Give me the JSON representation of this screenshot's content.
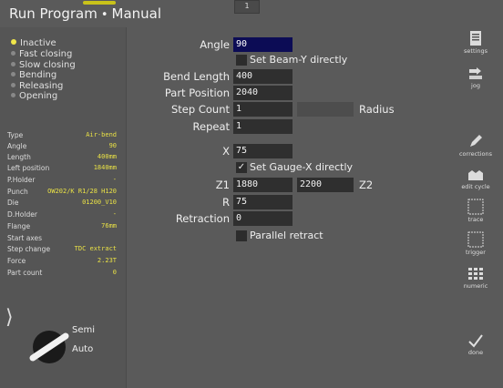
{
  "header": {
    "title_left": "Run Program",
    "title_sep": "•",
    "title_right": "Manual",
    "tab": "1"
  },
  "states": [
    {
      "label": "Inactive",
      "active": true
    },
    {
      "label": "Fast closing",
      "active": false
    },
    {
      "label": "Slow closing",
      "active": false
    },
    {
      "label": "Bending",
      "active": false
    },
    {
      "label": "Releasing",
      "active": false
    },
    {
      "label": "Opening",
      "active": false
    }
  ],
  "params": [
    {
      "k": "Type",
      "v": "Air-bend"
    },
    {
      "k": "Angle",
      "v": "90"
    },
    {
      "k": "Length",
      "v": "400mm"
    },
    {
      "k": "Left position",
      "v": "1840mm"
    },
    {
      "k": "P.Holder",
      "v": "-"
    },
    {
      "k": "Punch",
      "v": "OW202/K R1/28 H120"
    },
    {
      "k": "Die",
      "v": "01200_V10"
    },
    {
      "k": "D.Holder",
      "v": "-"
    },
    {
      "k": "Flange",
      "v": "76mm"
    },
    {
      "k": "Start axes",
      "v": ""
    },
    {
      "k": "Step change",
      "v": "TDC extract"
    },
    {
      "k": "Force",
      "v": "2.23T"
    },
    {
      "k": "Part count",
      "v": "0"
    }
  ],
  "mode": {
    "semi": "Semi",
    "auto": "Auto"
  },
  "form": {
    "angle_label": "Angle",
    "angle": "90",
    "set_beam_y": "Set Beam-Y directly",
    "bend_length_label": "Bend Length",
    "bend_length": "400",
    "part_position_label": "Part Position",
    "part_position": "2040",
    "step_count_label": "Step Count",
    "step_count": "1",
    "radius_label": "Radius",
    "repeat_label": "Repeat",
    "repeat": "1",
    "x_label": "X",
    "x": "75",
    "set_gauge_x": "Set Gauge-X directly",
    "z1_label": "Z1",
    "z1": "1880",
    "z2": "2200",
    "z2_label": "Z2",
    "r_label": "R",
    "r": "75",
    "retraction_label": "Retraction",
    "retraction": "0",
    "parallel_retract": "Parallel retract",
    "check_mark": "✓"
  },
  "toolbar": {
    "settings": "settings",
    "jog": "jog",
    "corrections": "corrections",
    "edit_cycle": "edit cycle",
    "trace": "trace",
    "trigger": "trigger",
    "numeric": "numeric",
    "done": "done"
  }
}
